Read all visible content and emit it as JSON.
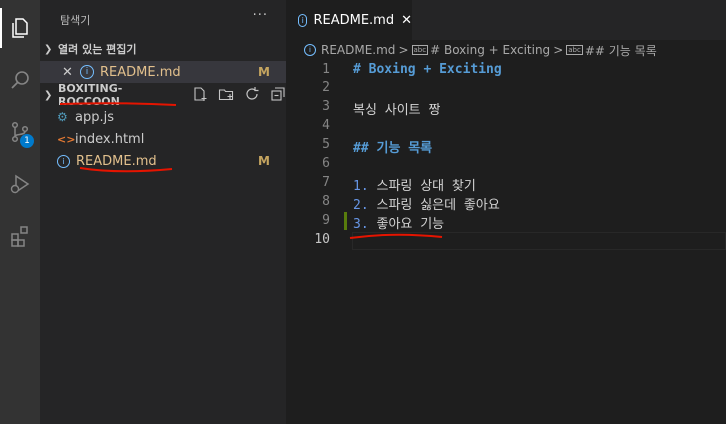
{
  "activity_bar": {
    "items": [
      {
        "name": "explorer-icon",
        "active": true
      },
      {
        "name": "search-icon"
      },
      {
        "name": "source-control-icon",
        "badge": "1"
      },
      {
        "name": "run-debug-icon"
      },
      {
        "name": "extensions-icon"
      }
    ]
  },
  "sidebar": {
    "title": "탐색기",
    "more": "···",
    "open_editors": {
      "header": "열려 있는 편집기",
      "items": [
        {
          "name": "README.md",
          "badge": "M"
        }
      ]
    },
    "folder": {
      "name": "BOXITING-ROCCOON",
      "files": [
        {
          "name": "app.js",
          "icon": "gear-icon"
        },
        {
          "name": "index.html",
          "icon": "html-icon"
        },
        {
          "name": "README.md",
          "icon": "info-icon",
          "badge": "M"
        }
      ]
    }
  },
  "editor": {
    "tab": {
      "label": "README.md"
    },
    "breadcrumb": {
      "file": "README.md",
      "sep": ">",
      "heading1": "# Boxing + Exciting",
      "heading2": "## 기능 목록"
    },
    "lines": [
      {
        "n": "1",
        "text": "# Boxing + Exciting"
      },
      {
        "n": "2",
        "text": ""
      },
      {
        "n": "3",
        "text": "복싱 사이트 짱"
      },
      {
        "n": "4",
        "text": ""
      },
      {
        "n": "5",
        "text": "## 기능 목록"
      },
      {
        "n": "6",
        "text": ""
      },
      {
        "n": "7",
        "num": "1.",
        "text": " 스파링 상대 찾기"
      },
      {
        "n": "8",
        "num": "2.",
        "text": " 스파링 싫은데 좋아요"
      },
      {
        "n": "9",
        "num": "3.",
        "text": " 좋아요 기능"
      },
      {
        "n": "10",
        "text": ""
      }
    ]
  },
  "colors": {
    "accent": "#007acc",
    "modified": "#e2c08d",
    "heading": "#569cd6",
    "annotation": "#e51400"
  }
}
